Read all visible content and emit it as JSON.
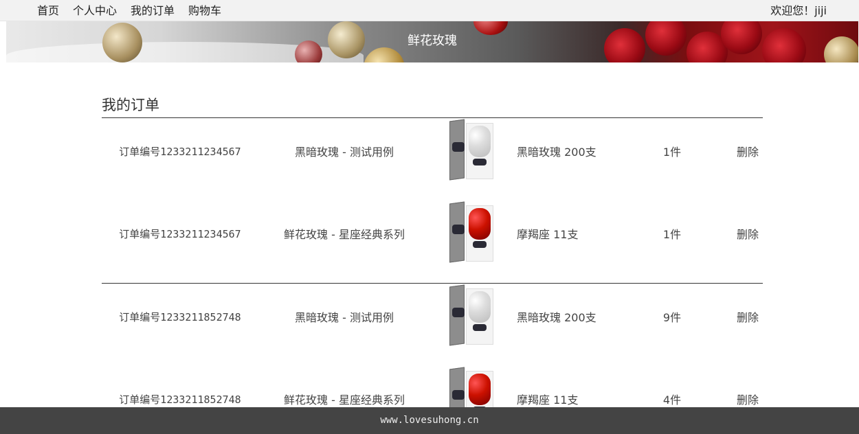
{
  "nav": {
    "links": [
      "首页",
      "个人中心",
      "我的订单",
      "购物车"
    ],
    "welcome": "欢迎您！jiji"
  },
  "banner": {
    "title": "鲜花玫瑰"
  },
  "page": {
    "title": "我的订单"
  },
  "orders": [
    {
      "items": [
        {
          "order_no": "订单编号1233211234567",
          "product": "黑暗玫瑰 - 测试用例",
          "image": "white-rose-box",
          "spec": "黑暗玫瑰 200支",
          "qty": "1件",
          "delete": "删除"
        },
        {
          "order_no": "订单编号1233211234567",
          "product": "鲜花玫瑰 - 星座经典系列",
          "image": "red-rose-box",
          "spec": "摩羯座 11支",
          "qty": "1件",
          "delete": "删除"
        }
      ]
    },
    {
      "items": [
        {
          "order_no": "订单编号1233211852748",
          "product": "黑暗玫瑰 - 测试用例",
          "image": "white-rose-box",
          "spec": "黑暗玫瑰 200支",
          "qty": "9件",
          "delete": "删除"
        },
        {
          "order_no": "订单编号1233211852748",
          "product": "鲜花玫瑰 - 星座经典系列",
          "image": "red-rose-box",
          "spec": "摩羯座 11支",
          "qty": "4件",
          "delete": "删除"
        }
      ]
    }
  ],
  "footer": {
    "text": "www.lovesuhong.cn"
  }
}
